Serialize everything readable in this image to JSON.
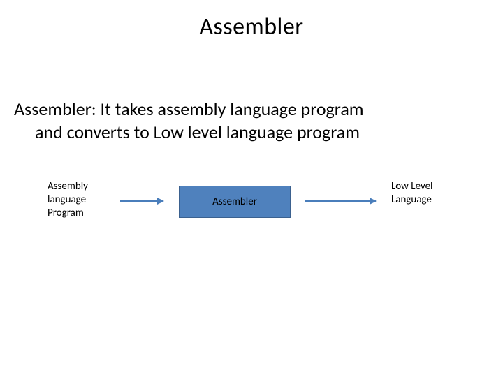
{
  "slide": {
    "title": "Assembler",
    "body_line1": "Assembler:  It takes assembly language program",
    "body_line2": "and converts to Low level language program"
  },
  "diagram": {
    "input_label_l1": "Assembly",
    "input_label_l2": "language",
    "input_label_l3": "Program",
    "process_label": "Assembler",
    "output_label_l1": "Low Level",
    "output_label_l2": "Language",
    "box_fill": "#4f81bd",
    "box_border": "#3b618f",
    "arrow_color": "#4a7ebb"
  }
}
